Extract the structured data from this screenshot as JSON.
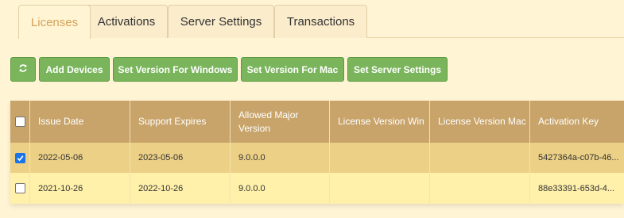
{
  "tabs": [
    {
      "label": "Licenses",
      "active": true
    },
    {
      "label": "Activations"
    },
    {
      "label": "Server Settings"
    },
    {
      "label": "Transactions"
    }
  ],
  "toolbar": {
    "refresh_icon": "refresh-icon",
    "add_devices": "Add Devices",
    "set_version_windows": "Set Version For Windows",
    "set_version_mac": "Set Version For Mac",
    "set_server_settings": "Set Server Settings",
    "button_color": "#7ab55c"
  },
  "table": {
    "columns": [
      "Issue Date",
      "Support Expires",
      "Allowed Major Version",
      "License Version Win",
      "License Version Mac",
      "Activation Key"
    ],
    "rows": [
      {
        "checked": true,
        "issue_date": "2022-05-06",
        "support_expires": "2023-05-06",
        "allowed_major_version": "9.0.0.0",
        "license_version_win": "",
        "license_version_mac": "",
        "activation_key": "5427364a-c07b-46..."
      },
      {
        "checked": false,
        "issue_date": "2021-10-26",
        "support_expires": "2022-10-26",
        "allowed_major_version": "9.0.0.0",
        "license_version_win": "",
        "license_version_mac": "",
        "activation_key": "88e33391-653d-4..."
      }
    ]
  },
  "colors": {
    "header_bg": "#c8a46a",
    "selected_row_bg": "#ecd086",
    "row_bg": "#fff0aa",
    "active_tab_text": "#d3a35a"
  }
}
